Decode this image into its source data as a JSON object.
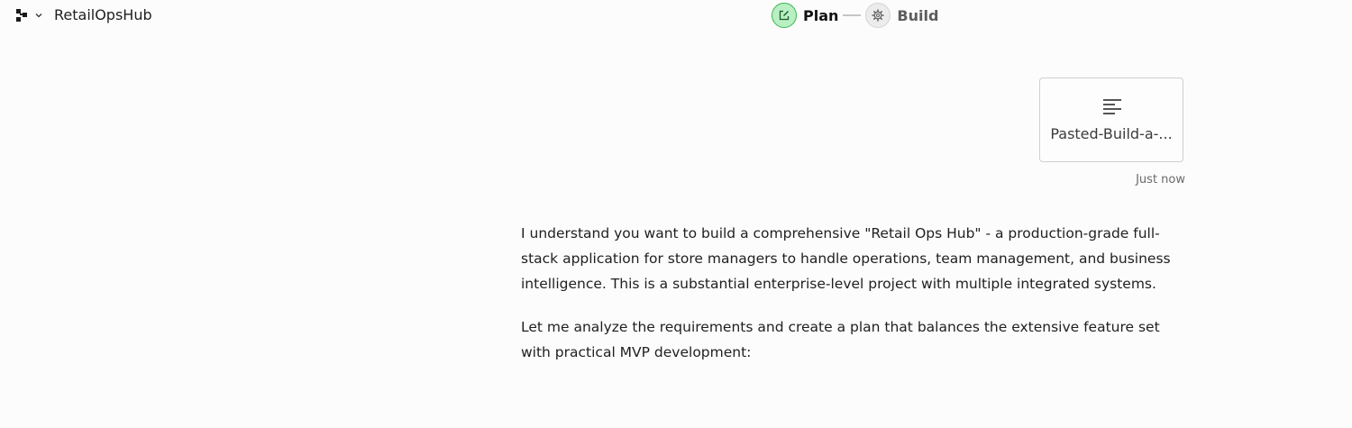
{
  "project": {
    "name": "RetailOpsHub",
    "logo_icon": "org-tree-icon",
    "dropdown_icon": "chevron-down-icon"
  },
  "steps": [
    {
      "label": "Plan",
      "icon": "edit-icon",
      "state": "active"
    },
    {
      "label": "Build",
      "icon": "gear-icon",
      "state": "inactive"
    }
  ],
  "attachment": {
    "name": "Pasted-Build-a-...",
    "icon": "text-lines-icon",
    "timestamp": "Just now"
  },
  "message": {
    "paragraphs": [
      "I understand you want to build a comprehensive \"Retail Ops Hub\" - a production-grade full-stack application for store managers to handle operations, team management, and business intelligence. This is a substantial enterprise-level project with multiple integrated systems.",
      "Let me analyze the requirements and create a plan that balances the extensive feature set with practical MVP development:"
    ]
  },
  "colors": {
    "plan_active_bg": "#b9efc2",
    "plan_active_border": "#3cb552",
    "background": "#fcfcfc"
  }
}
